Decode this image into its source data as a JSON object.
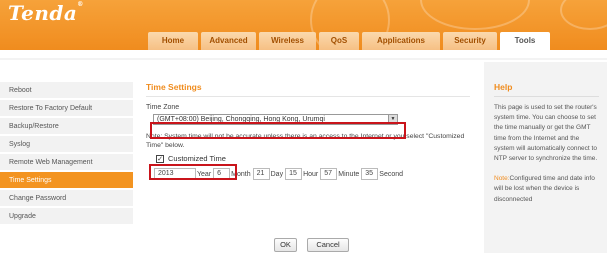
{
  "header": {
    "logo": "Tenda",
    "tabs": [
      "Home",
      "Advanced",
      "Wireless",
      "QoS",
      "Applications",
      "Security",
      "Tools"
    ],
    "active_tab": "Tools"
  },
  "sidebar": {
    "items": [
      "Reboot",
      "Restore To Factory Default",
      "Backup/Restore",
      "Syslog",
      "Remote Web Management",
      "Time Settings",
      "Change Password",
      "Upgrade"
    ],
    "active": "Time Settings"
  },
  "main": {
    "title": "Time Settings",
    "timezone_label": "Time Zone",
    "timezone_value": "(GMT+08:00) Beijing, Chongqing, Hong Kong, Urumqi",
    "note": "Note: System time will not be accurate unless there is an access to the Internet or you select \"Customized Time\" below.",
    "customized_label": "Customized Time",
    "customized_checked": true,
    "year_value": "2013",
    "year_label": "Year",
    "month_value": "6",
    "month_label": "Month",
    "day_value": "21",
    "day_label": "Day",
    "hour_value": "15",
    "hour_label": "Hour",
    "minute_value": "57",
    "minute_label": "Minute",
    "second_value": "35",
    "second_label": "Second",
    "ok_label": "OK",
    "cancel_label": "Cancel"
  },
  "help": {
    "title": "Help",
    "text": "This page is used to set the router's system time. You can choose to set the time manually or get the GMT time from the Internet and the system will automatically connect to NTP server to synchronize the time.",
    "note_label": "Note:",
    "note_text": "Configured time and date info will be lost when the device is disconnected"
  },
  "colors": {
    "brand_orange": "#f39421",
    "highlight_red": "#c9141b"
  }
}
